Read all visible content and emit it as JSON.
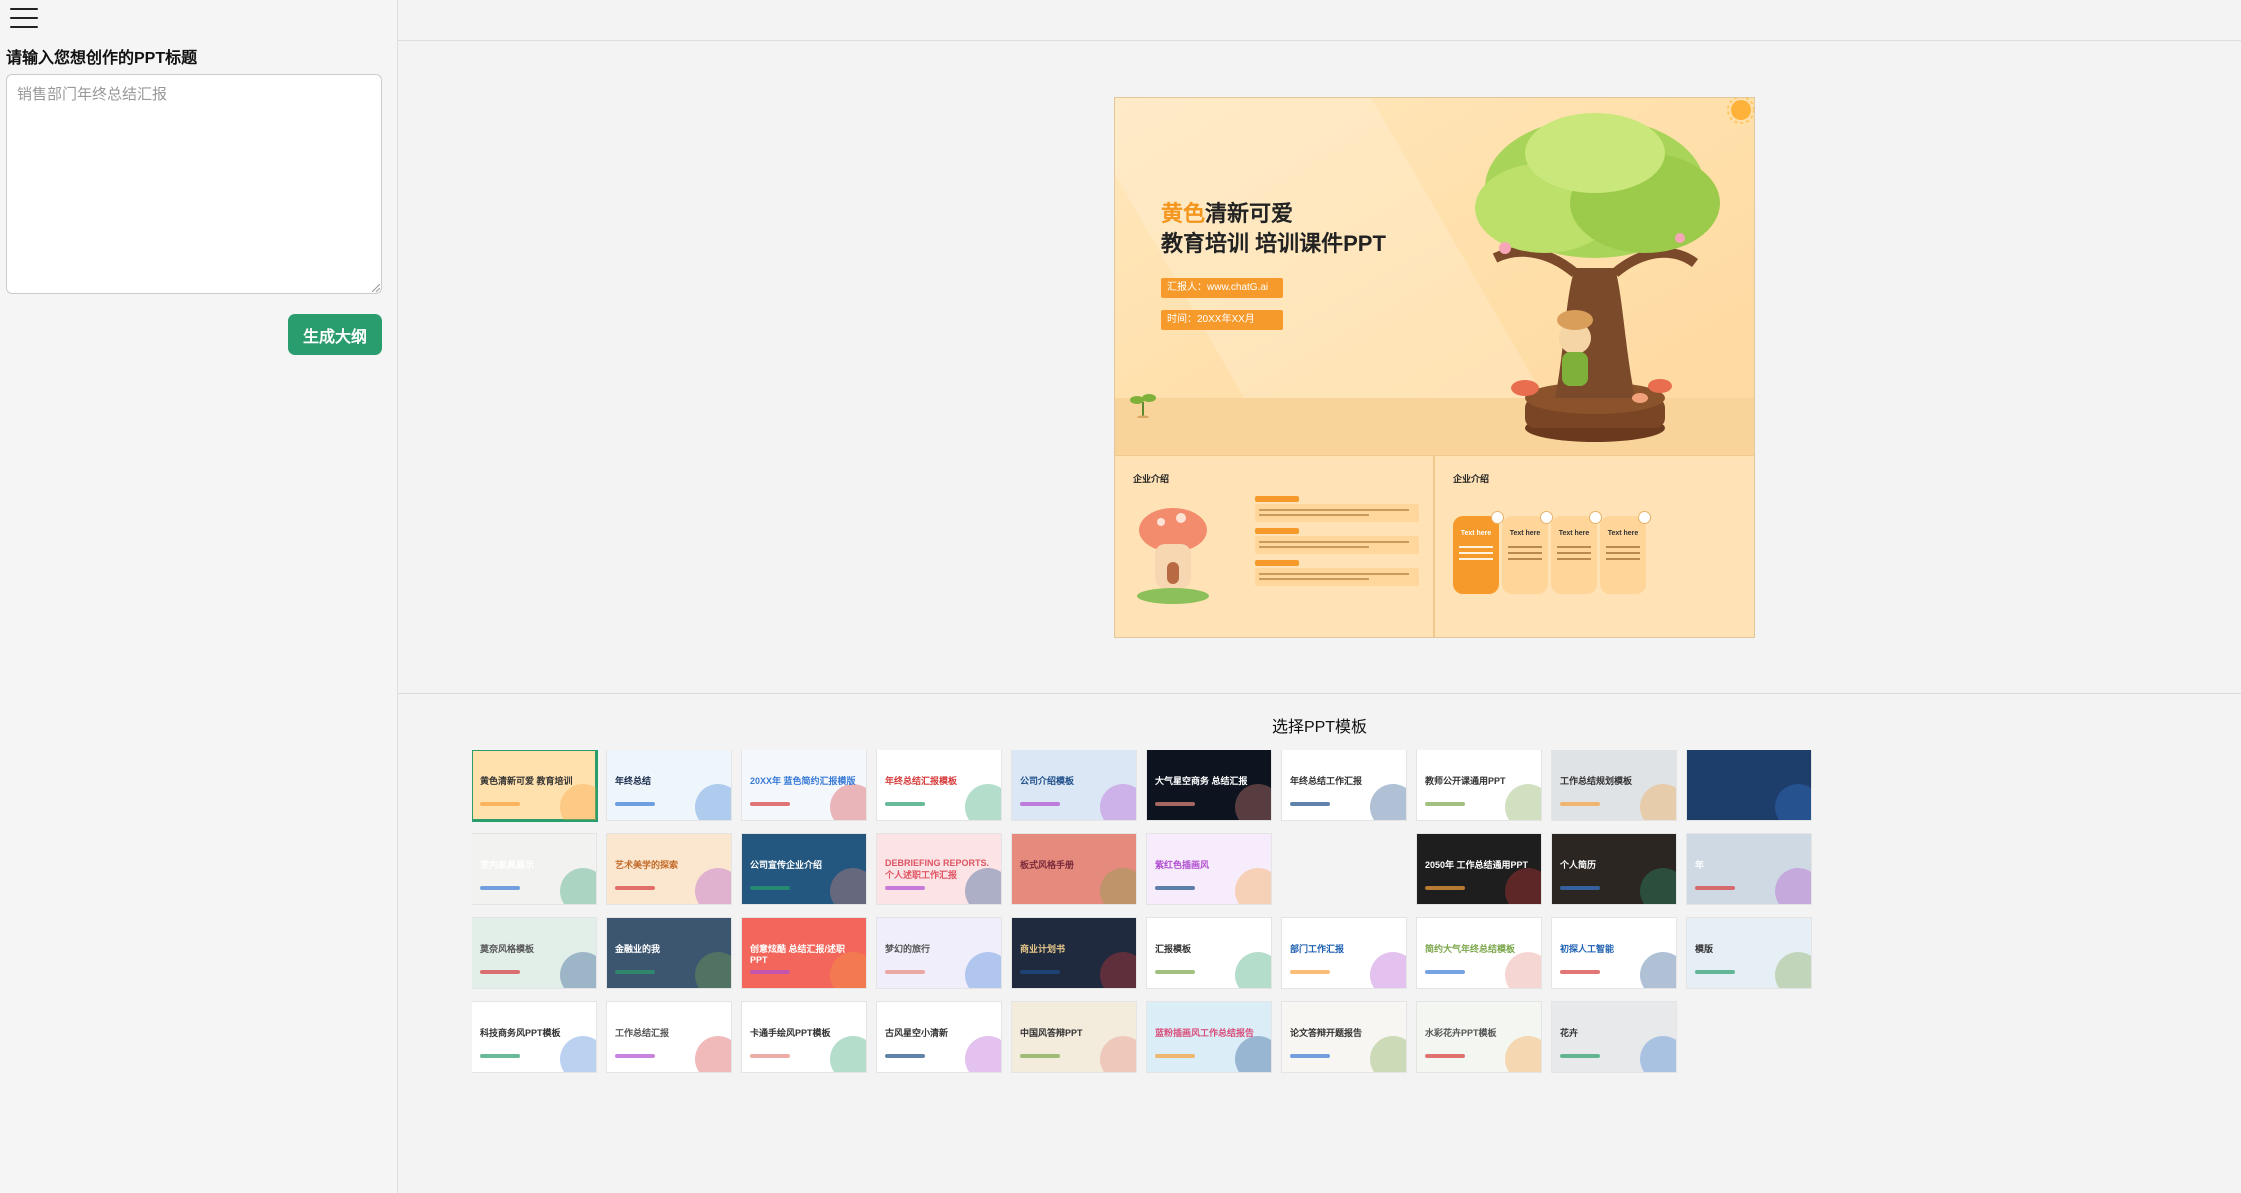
{
  "sidebar": {
    "menu_icon": "hamburger-menu-icon",
    "prompt_label": "请输入您想创作的PPT标题",
    "prompt_placeholder": "销售部门年终总结汇报",
    "prompt_value": "",
    "generate_button": "生成大纲"
  },
  "preview": {
    "title_highlight": "黄色",
    "title_rest": "清新可爱",
    "title_line2": "教育培训 培训课件PPT",
    "reporter_tag": "汇报人：www.chatG.ai",
    "time_tag": "时间：20XX年XX月",
    "sub_left_heading": "企业介绍",
    "sub_right_heading": "企业介绍",
    "step_labels": [
      "Text here",
      "Text here",
      "Text here",
      "Text here"
    ]
  },
  "templates": {
    "heading": "选择PPT模板",
    "selected_index": 0,
    "rows": [
      [
        {
          "text": "黄色清新可爱 教育培训",
          "bg": "#ffe1ad",
          "fg": "#333"
        },
        {
          "text": "年终总结",
          "bg": "#eef6fb",
          "fg": "#1a2b4a"
        },
        {
          "text": "20XX年 蓝色简约汇报模版",
          "bg": "#f4f8fd",
          "fg": "#3a7bd5"
        },
        {
          "text": "年终总结汇报模板",
          "bg": "#ffffff",
          "fg": "#d63a3a"
        },
        {
          "text": "公司介绍模板",
          "bg": "#dbe7f4",
          "fg": "#1d4e89"
        },
        {
          "text": "大气星空商务 总结汇报",
          "bg": "#0d1420",
          "fg": "#ffffff"
        },
        {
          "text": "年终总结工作汇报",
          "bg": "#ffffff",
          "fg": "#333"
        },
        {
          "text": "教师公开课通用PPT",
          "bg": "#ffffff",
          "fg": "#333"
        },
        {
          "text": "工作总结规划模板",
          "bg": "#dfe3e6",
          "fg": "#333"
        },
        {
          "text": "",
          "bg": "#1d3d6a",
          "fg": "#fff"
        }
      ],
      [
        {
          "text": "室内家具展示",
          "bg": "#f2f2f0",
          "fg": "#fff"
        },
        {
          "text": "艺术美学的探索",
          "bg": "#fbe6cf",
          "fg": "#c26b28"
        },
        {
          "text": "公司宣传企业介绍",
          "bg": "#23577f",
          "fg": "#ffffff"
        },
        {
          "text": "DEBRIEFING REPORTS. 个人述职工作汇报",
          "bg": "#fbe3e6",
          "fg": "#e05563"
        },
        {
          "text": "板式风格手册",
          "bg": "#e58a7d",
          "fg": "#7a2a3a"
        },
        {
          "text": "紫红色插画风",
          "bg": "#f6ecfb",
          "fg": "#b14fd1"
        },
        {
          "text": "",
          "bg": "#f3f3f3",
          "fg": "#333"
        },
        {
          "text": "2050年 工作总结通用PPT",
          "bg": "#1e1e1e",
          "fg": "#ffffff"
        },
        {
          "text": "个人简历",
          "bg": "#2b2622",
          "fg": "#ffffff"
        },
        {
          "text": "年",
          "bg": "#cfd9e3",
          "fg": "#fff"
        }
      ],
      [
        {
          "text": "莫奈风格模板",
          "bg": "#e2efe9",
          "fg": "#555"
        },
        {
          "text": "金融业的我",
          "bg": "#3d5670",
          "fg": "#ffffff"
        },
        {
          "text": "创意炫酷 总结汇报/述职PPT",
          "bg": "#f2665b",
          "fg": "#ffffff"
        },
        {
          "text": "梦幻的旅行",
          "bg": "#f1eefc",
          "fg": "#555"
        },
        {
          "text": "商业计划书",
          "bg": "#1f2a3e",
          "fg": "#e7c98a"
        },
        {
          "text": "汇报模板",
          "bg": "#ffffff",
          "fg": "#333"
        },
        {
          "text": "部门工作汇报",
          "bg": "#ffffff",
          "fg": "#1d5fb0"
        },
        {
          "text": "简约大气年终总结模板",
          "bg": "#ffffff",
          "fg": "#7aa64a"
        },
        {
          "text": "初探人工智能",
          "bg": "#ffffff",
          "fg": "#1d5fb0"
        },
        {
          "text": "模版",
          "bg": "#e6eef6",
          "fg": "#333"
        }
      ],
      [
        {
          "text": "科技商务风PPT模板",
          "bg": "#ffffff",
          "fg": "#333"
        },
        {
          "text": "工作总结汇报",
          "bg": "#ffffff",
          "fg": "#555"
        },
        {
          "text": "卡通手绘风PPT模板",
          "bg": "#ffffff",
          "fg": "#333"
        },
        {
          "text": "古风星空小清新",
          "bg": "#ffffff",
          "fg": "#333"
        },
        {
          "text": "中国风答辩PPT",
          "bg": "#f3ebdc",
          "fg": "#333"
        },
        {
          "text": "蓝粉插画风工作总结报告",
          "bg": "#dbeef8",
          "fg": "#d94f7b"
        },
        {
          "text": "论文答辩开题报告",
          "bg": "#f8f6f2",
          "fg": "#333"
        },
        {
          "text": "水彩花卉PPT模板",
          "bg": "#f4f6f1",
          "fg": "#555"
        },
        {
          "text": "花卉",
          "bg": "#e7e9ea",
          "fg": "#333"
        },
        {
          "text": "",
          "bg": "#f3f3f3",
          "fg": "#333"
        }
      ]
    ]
  }
}
